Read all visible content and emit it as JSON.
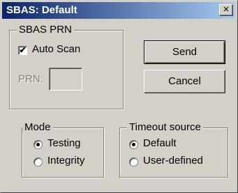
{
  "window": {
    "title": "SBAS: Default",
    "close_glyph": "×",
    "close_icon": "close-icon"
  },
  "sbas_prn": {
    "legend": "SBAS PRN",
    "auto_scan_label": "Auto Scan",
    "auto_scan_checked": true,
    "check_glyph": "✔",
    "prn_label": "PRN:",
    "prn_value": ""
  },
  "buttons": {
    "send_label": "Send",
    "cancel_label": "Cancel"
  },
  "mode": {
    "legend": "Mode",
    "options": [
      {
        "label": "Testing",
        "selected": true
      },
      {
        "label": "Integrity",
        "selected": false
      }
    ]
  },
  "timeout_source": {
    "legend": "Timeout source",
    "options": [
      {
        "label": "Default",
        "selected": true
      },
      {
        "label": "User-defined",
        "selected": false
      }
    ]
  },
  "colors": {
    "title_start": "#0a246a",
    "title_end": "#a6caf0",
    "face": "#d4d0c8"
  }
}
